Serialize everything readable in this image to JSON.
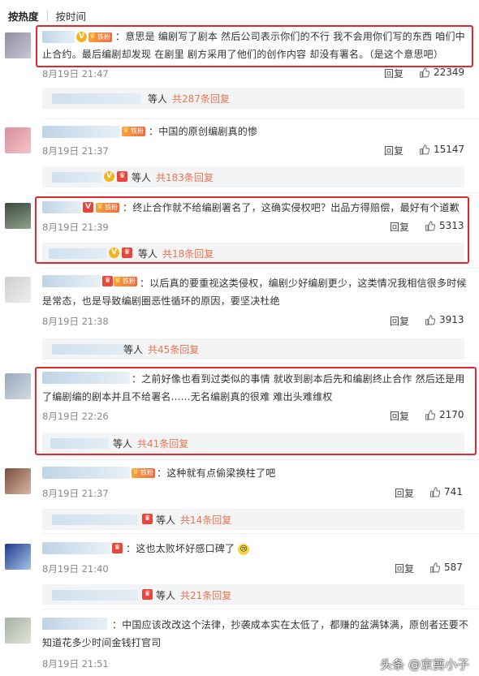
{
  "tabs": {
    "hot": "按热度",
    "time": "按时间"
  },
  "icons": {
    "like": "thumbs-up-icon",
    "vip": "v-badge-icon",
    "fan": "crown-fan-badge-icon"
  },
  "colors": {
    "accent": "#eb7350",
    "highlight_box": "#e5262b"
  },
  "fan_label": "铁粉",
  "comments": [
    {
      "text_lines": [
        "：意思是  编剧写了剧本 然后公司表示你们的不行 我不会用你们写的东西 咱们中",
        "止合约。最后编剧却发现 在剧里 剧方采用了他们的创作内容 却没有署名。（是这个意思吧）"
      ],
      "time": "8月19日 21:47",
      "reply": "回复",
      "likes": "22349",
      "sub_suffix": "等人",
      "sub_link": "共287条回复"
    },
    {
      "text_lines": [
        "：中国的原创编剧真的惨"
      ],
      "time": "8月19日 21:37",
      "reply": "回复",
      "likes": "15147",
      "sub_suffix": "等人",
      "sub_link": "共183条回复"
    },
    {
      "text_lines": [
        "：终止合作就不给编剧署名了，这确实侵权吧？出品方得赔偿，最好有个道歉"
      ],
      "time": "8月19日 21:39",
      "reply": "回复",
      "likes": "5313",
      "sub_suffix": "等人",
      "sub_link": "共18条回复"
    },
    {
      "text_lines": [
        "：以后真的要重视这类侵权，编剧少好编剧更少，这类情况我相信很多时候",
        "是常态，也是导致编剧圈恶性循环的原因，要坚决杜绝"
      ],
      "time": "8月19日 21:38",
      "reply": "回复",
      "likes": "3913",
      "sub_suffix": "等人",
      "sub_link": "共45条回复"
    },
    {
      "text_lines": [
        "：之前好像也看到过类似的事情 就收到剧本后先和编剧终止合作 然后还是用",
        "了编剧编的剧本并且不给署名......无名编剧真的很难 难出头难维权"
      ],
      "time": "8月19日 22:26",
      "reply": "回复",
      "likes": "2170",
      "sub_suffix": "等人",
      "sub_link": "共41条回复"
    },
    {
      "text_lines": [
        "：这种就有点偷梁换柱了吧"
      ],
      "time": "8月19日 21:37",
      "reply": "回复",
      "likes": "741",
      "sub_suffix": "等人",
      "sub_link": "共14条回复"
    },
    {
      "text_lines": [
        "：这也太败坏好感口碑了"
      ],
      "time": "8月19日 21:40",
      "reply": "回复",
      "likes": "587",
      "sub_suffix": "等人",
      "sub_link": "共21条回复"
    },
    {
      "text_lines": [
        "：中国应该改改这个法律，抄袭成本实在太低了，都赚的盆满钵满，原创者还要不",
        "知道花多少时间金钱打官司"
      ],
      "time": "8月19日 21:51",
      "reply": "",
      "likes": "",
      "sub_suffix": "",
      "sub_link": ""
    }
  ],
  "watermark": "头条 @京剪小子"
}
